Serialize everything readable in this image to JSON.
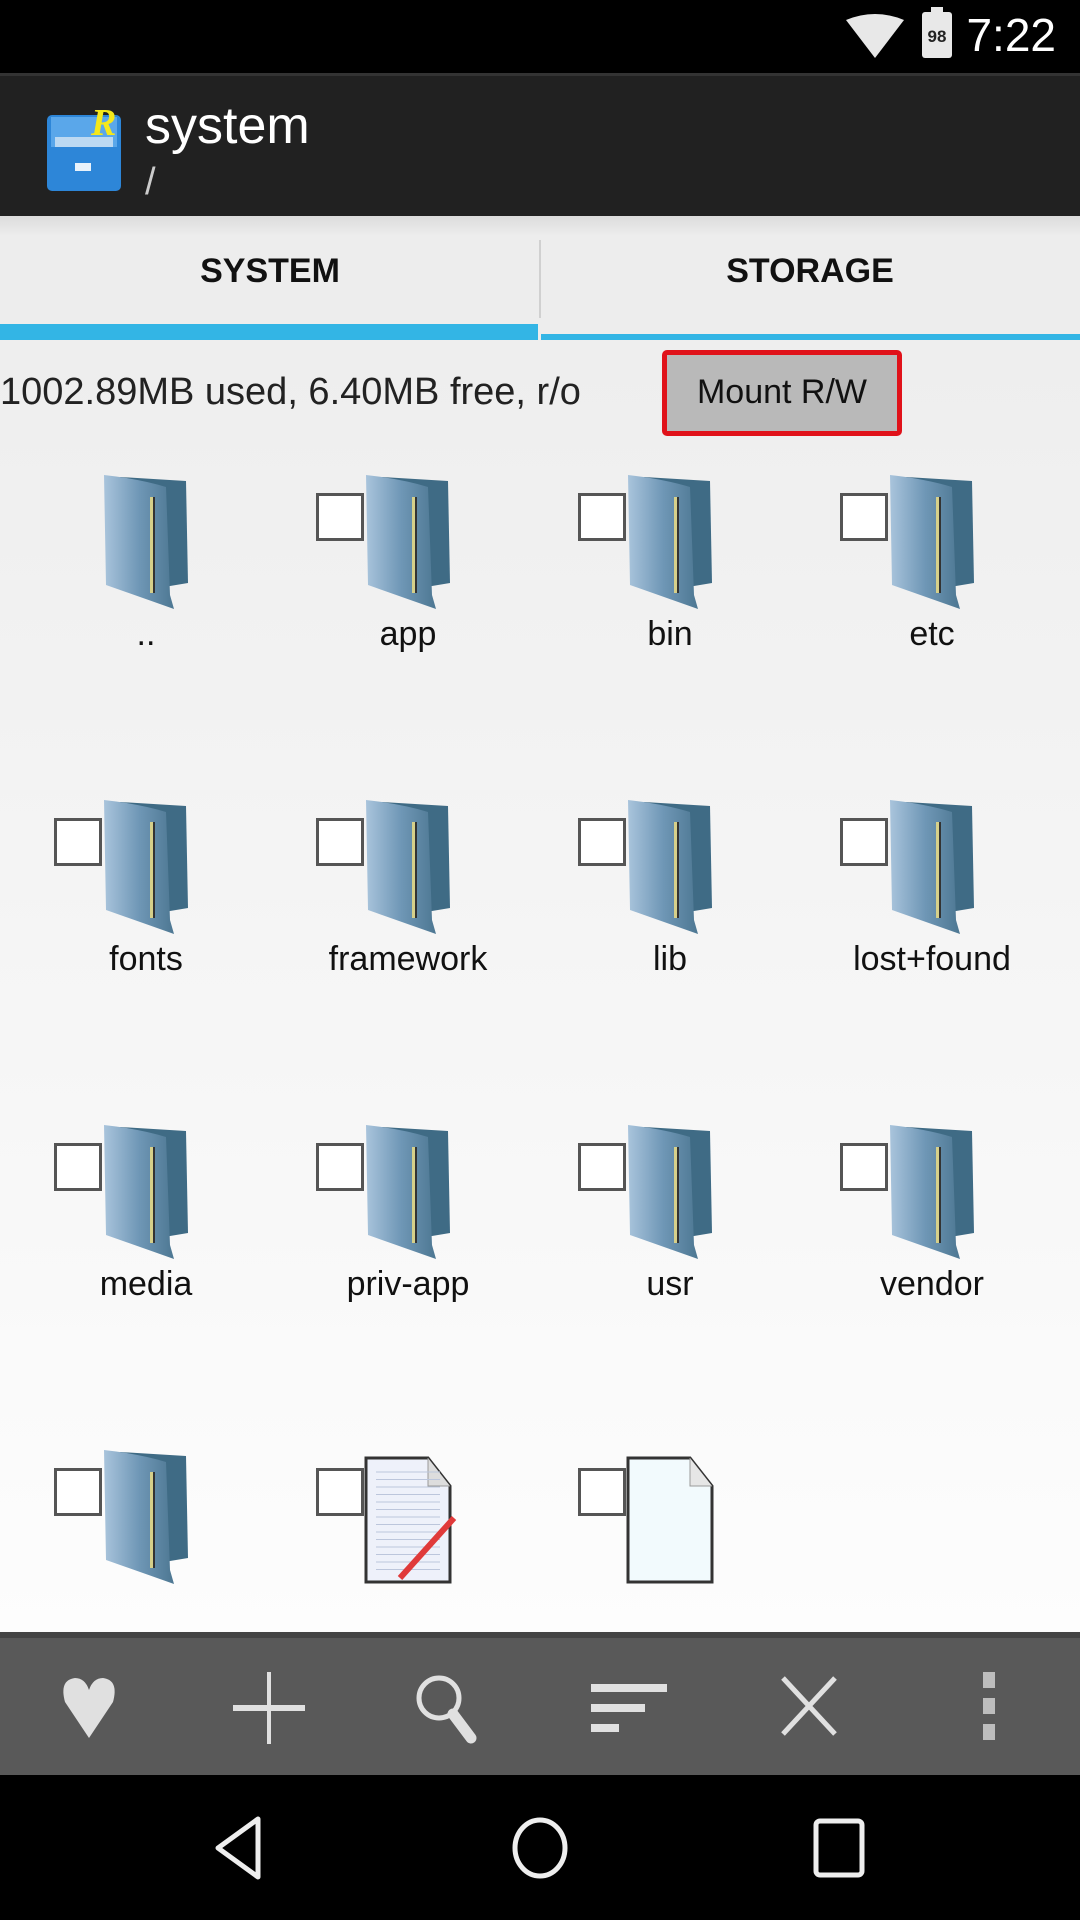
{
  "status_bar": {
    "time": "7:22",
    "battery": "98",
    "icons": [
      "wifi-icon",
      "battery-icon"
    ]
  },
  "app_bar": {
    "title": "system",
    "subtitle": "/",
    "icon": "root-explorer-app-icon"
  },
  "tabs": [
    {
      "label": "SYSTEM",
      "selected": true
    },
    {
      "label": "STORAGE",
      "selected": false
    }
  ],
  "info": {
    "text": "1002.89MB used, 6.40MB free, r/o",
    "mount_button": "Mount R/W"
  },
  "colors": {
    "accent": "#33b5e5",
    "highlight": "#e0121a",
    "toolbar": "#595959",
    "appbar": "#212121"
  },
  "items": [
    {
      "name": "..",
      "type": "folder",
      "checkbox": false
    },
    {
      "name": "app",
      "type": "folder",
      "checkbox": true
    },
    {
      "name": "bin",
      "type": "folder",
      "checkbox": true
    },
    {
      "name": "etc",
      "type": "folder",
      "checkbox": true
    },
    {
      "name": "fonts",
      "type": "folder",
      "checkbox": true
    },
    {
      "name": "framework",
      "type": "folder",
      "checkbox": true
    },
    {
      "name": "lib",
      "type": "folder",
      "checkbox": true
    },
    {
      "name": "lost+found",
      "type": "folder",
      "checkbox": true
    },
    {
      "name": "media",
      "type": "folder",
      "checkbox": true
    },
    {
      "name": "priv-app",
      "type": "folder",
      "checkbox": true
    },
    {
      "name": "usr",
      "type": "folder",
      "checkbox": true
    },
    {
      "name": "vendor",
      "type": "folder",
      "checkbox": true
    },
    {
      "name": "",
      "type": "folder",
      "checkbox": true
    },
    {
      "name": "",
      "type": "text-file",
      "checkbox": true
    },
    {
      "name": "",
      "type": "file",
      "checkbox": true
    }
  ],
  "toolbar": [
    "favorite-icon",
    "add-icon",
    "search-icon",
    "sort-icon",
    "close-icon",
    "overflow-menu-icon"
  ],
  "nav_bar": [
    "back-icon",
    "home-icon",
    "recents-icon"
  ]
}
